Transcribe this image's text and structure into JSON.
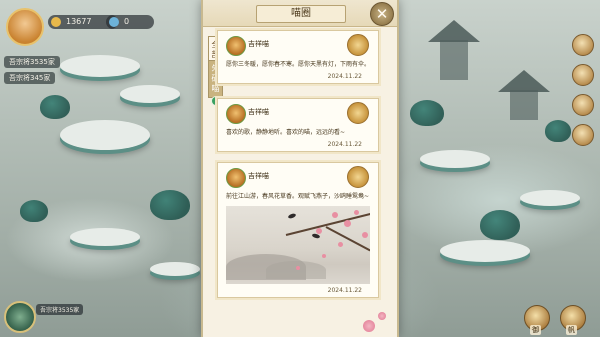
{
  "hud": {
    "currency_1": "13677",
    "currency_2": "0",
    "player_tag": " ",
    "side_tag_1": "吾宗将3535家",
    "side_tag_2": "吾宗将345家",
    "corner_tag": "吾宗将3535家"
  },
  "bottom_bar": {
    "items": [
      {
        "label": "御"
      },
      {
        "label": "帆"
      }
    ]
  },
  "panel": {
    "title": "喵圈",
    "close_icon": "✕",
    "filter_tabs": [
      {
        "label": "全部",
        "active": false
      },
      {
        "label": "朱砂喵",
        "active": true
      }
    ],
    "posts": [
      {
        "author": "吉祥喵",
        "text": "愿你三冬暖，愿你春不寒。愿你天黑有灯，下雨有伞。",
        "date": "2024.11.22"
      },
      {
        "author": "吉祥喵",
        "text": "喜欢的歌，静静地听。喜欢的喵，远远的看~",
        "date": "2024.11.22"
      },
      {
        "author": "吉祥喵",
        "text": "前往江山游，春风花草香。观赋飞燕子，沙鸥睡鸳鸯~",
        "date": "2024.11.22"
      }
    ]
  },
  "colors": {
    "panel_bg": "#f7f1e3",
    "accent": "#c9b380",
    "blossom": "#e88fa2"
  }
}
